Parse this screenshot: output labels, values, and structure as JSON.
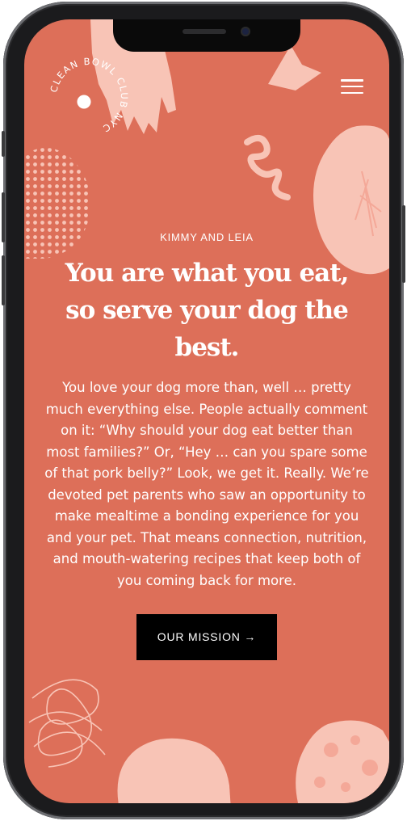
{
  "brand": {
    "logo_text": "CLEAN BOWL CLUB NYC"
  },
  "header": {
    "menu_icon": "hamburger-menu-icon"
  },
  "hero": {
    "eyebrow": "KIMMY AND LEIA",
    "headline": "You are what you eat, so serve your dog the best.",
    "body": "You love your dog more than, well … pretty much everything else. People actually comment on it: “Why should your dog eat better than most families?” Or, “Hey … can you spare some of that pork belly?” Look, we get it. Really. We’re devoted pet parents who saw an opportunity to make mealtime a bonding experience for you and your pet. That means connection, nutrition, and mouth-watering recipes that keep both of you coming back for more.",
    "cta_label": "OUR MISSION →"
  },
  "colors": {
    "background": "#dd6f59",
    "shape_light": "#f8c4b6",
    "shape_mid": "#f4a898",
    "cta_bg": "#000000",
    "text": "#ffffff"
  }
}
